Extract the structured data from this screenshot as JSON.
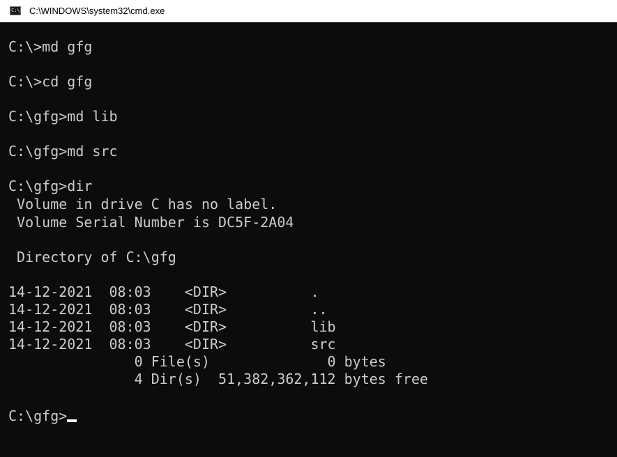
{
  "window": {
    "title": "C:\\WINDOWS\\system32\\cmd.exe",
    "icon": "cmd-icon",
    "icon_glyph": "C:\\"
  },
  "console": {
    "lines": [
      "C:\\>md gfg",
      "C:\\>cd gfg",
      "C:\\gfg>md lib",
      "C:\\gfg>md src",
      "C:\\gfg>dir",
      " Volume in drive C has no label.",
      " Volume Serial Number is DC5F-2A04",
      " Directory of C:\\gfg",
      "14-12-2021  08:03    <DIR>          .",
      "14-12-2021  08:03    <DIR>          ..",
      "14-12-2021  08:03    <DIR>          lib",
      "14-12-2021  08:03    <DIR>          src",
      "               0 File(s)              0 bytes",
      "               4 Dir(s)  51,382,362,112 bytes free"
    ],
    "prompt": "C:\\gfg>"
  },
  "colors": {
    "background": "#0c0c0c",
    "text": "#cccccc",
    "titlebar": "#ffffff"
  }
}
